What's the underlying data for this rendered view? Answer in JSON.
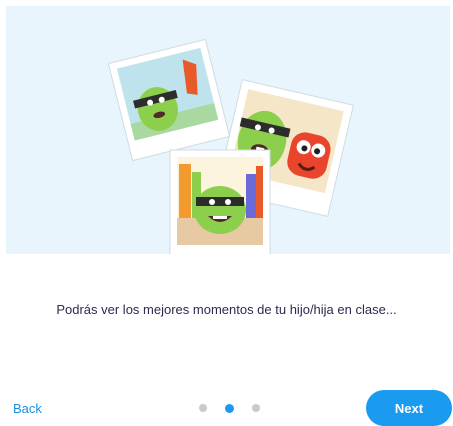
{
  "illustration": {
    "description_icon": "classroom-photos-illustration"
  },
  "onboarding": {
    "caption": "Podrás ver los mejores momentos de tu hijo/hija en clase...",
    "back_label": "Back",
    "next_label": "Next",
    "pager": {
      "total": 3,
      "current": 2
    }
  },
  "colors": {
    "accent": "#1a9bf0",
    "hero_bg": "#e9f5fc",
    "text": "#2c2a50",
    "dot_inactive": "#c9c9ce"
  }
}
